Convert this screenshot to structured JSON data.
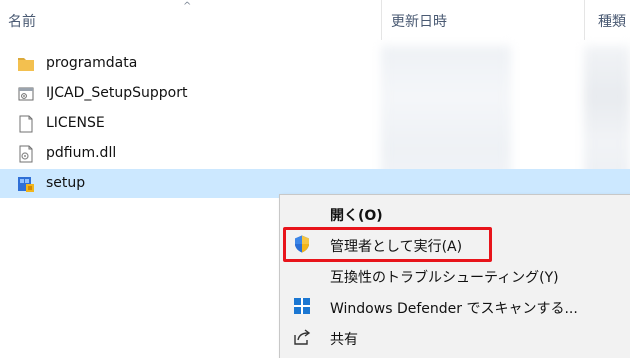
{
  "header": {
    "name_label": "名前",
    "date_label": "更新日時",
    "type_label": "種類",
    "sort_indicator": "^"
  },
  "files": [
    {
      "name": "programdata",
      "icon": "folder-icon",
      "selected": false
    },
    {
      "name": "IJCAD_SetupSupport",
      "icon": "app-icon",
      "selected": false
    },
    {
      "name": "LICENSE",
      "icon": "document-icon",
      "selected": false
    },
    {
      "name": "pdfium.dll",
      "icon": "dll-icon",
      "selected": false
    },
    {
      "name": "setup",
      "icon": "setup-icon",
      "selected": true
    }
  ],
  "context_menu": {
    "items": [
      {
        "label": "開く(O)",
        "icon": "",
        "bold": true
      },
      {
        "label": "管理者として実行(A)",
        "icon": "uac-shield-icon",
        "bold": false,
        "highlighted": true
      },
      {
        "label": "互換性のトラブルシューティング(Y)",
        "icon": "",
        "bold": false
      },
      {
        "label": "Windows Defender でスキャンする...",
        "icon": "windows-defender-icon",
        "bold": false
      },
      {
        "label": "共有",
        "icon": "share-icon",
        "bold": false
      }
    ]
  },
  "colors": {
    "selection": "#cce8ff",
    "highlight_border": "#e8141b",
    "folder": "#f3c04f",
    "menu_background": "#f2f2f2"
  }
}
